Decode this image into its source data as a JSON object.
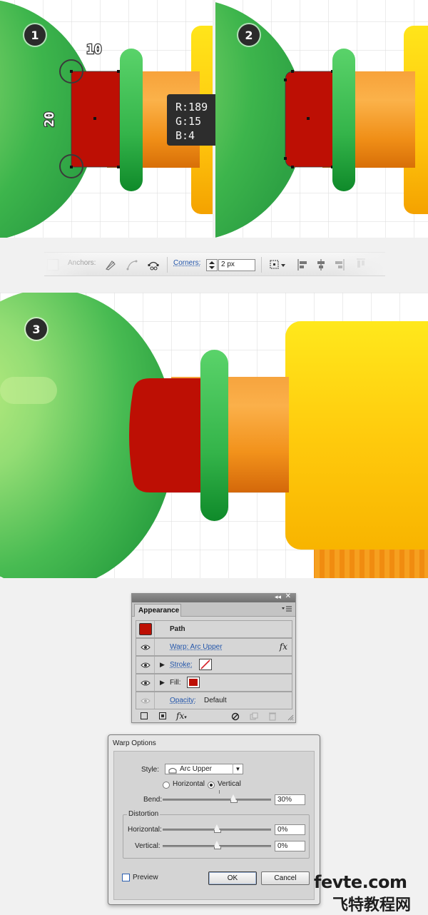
{
  "steps": {
    "step1": "1",
    "step2": "2",
    "step3": "3"
  },
  "dimensions": {
    "width_label": "10",
    "height_label": "20"
  },
  "color_tooltip": {
    "r": "R:189",
    "g": "G:15",
    "b": "B:4"
  },
  "colors": {
    "fill_red": "#bd0f04",
    "green": "#3dbb4e",
    "orange": "#f7941d",
    "yellow": "#ffc20e",
    "grid": "#d9d9d9"
  },
  "control_bar": {
    "anchors_label": "Anchors:",
    "corners_label": "Corners:",
    "corners_value": "2 px",
    "icons": [
      "convert-anchor-icon",
      "smooth-anchor-icon",
      "cut-path-icon",
      "transform-icon",
      "align-left-icon",
      "align-center-icon",
      "align-right-icon",
      "distribute-icon"
    ]
  },
  "appearance": {
    "tab_label": "Appearance",
    "object_label": "Path",
    "warp_effect": "Warp: Arc Upper",
    "fx_label": "fx",
    "stroke_label": "Stroke:",
    "fill_label": "Fill:",
    "opacity_label": "Opacity:",
    "opacity_value": "Default"
  },
  "warp_options": {
    "title": "Warp Options",
    "style_label": "Style:",
    "style_value": "Arc Upper",
    "horizontal_label": "Horizontal",
    "vertical_label": "Vertical",
    "orientation_selected": "Vertical",
    "bend_label": "Bend:",
    "bend_value": "30%",
    "bend_level": 0.65,
    "distortion_label": "Distortion",
    "dist_horizontal_label": "Horizontal:",
    "dist_horizontal_value": "0%",
    "dist_vertical_label": "Vertical:",
    "dist_vertical_value": "0%",
    "preview_label": "Preview",
    "preview_checked": false,
    "ok_label": "OK",
    "cancel_label": "Cancel"
  },
  "watermark": {
    "line1": "fevte.com",
    "line2": "飞特教程网"
  }
}
